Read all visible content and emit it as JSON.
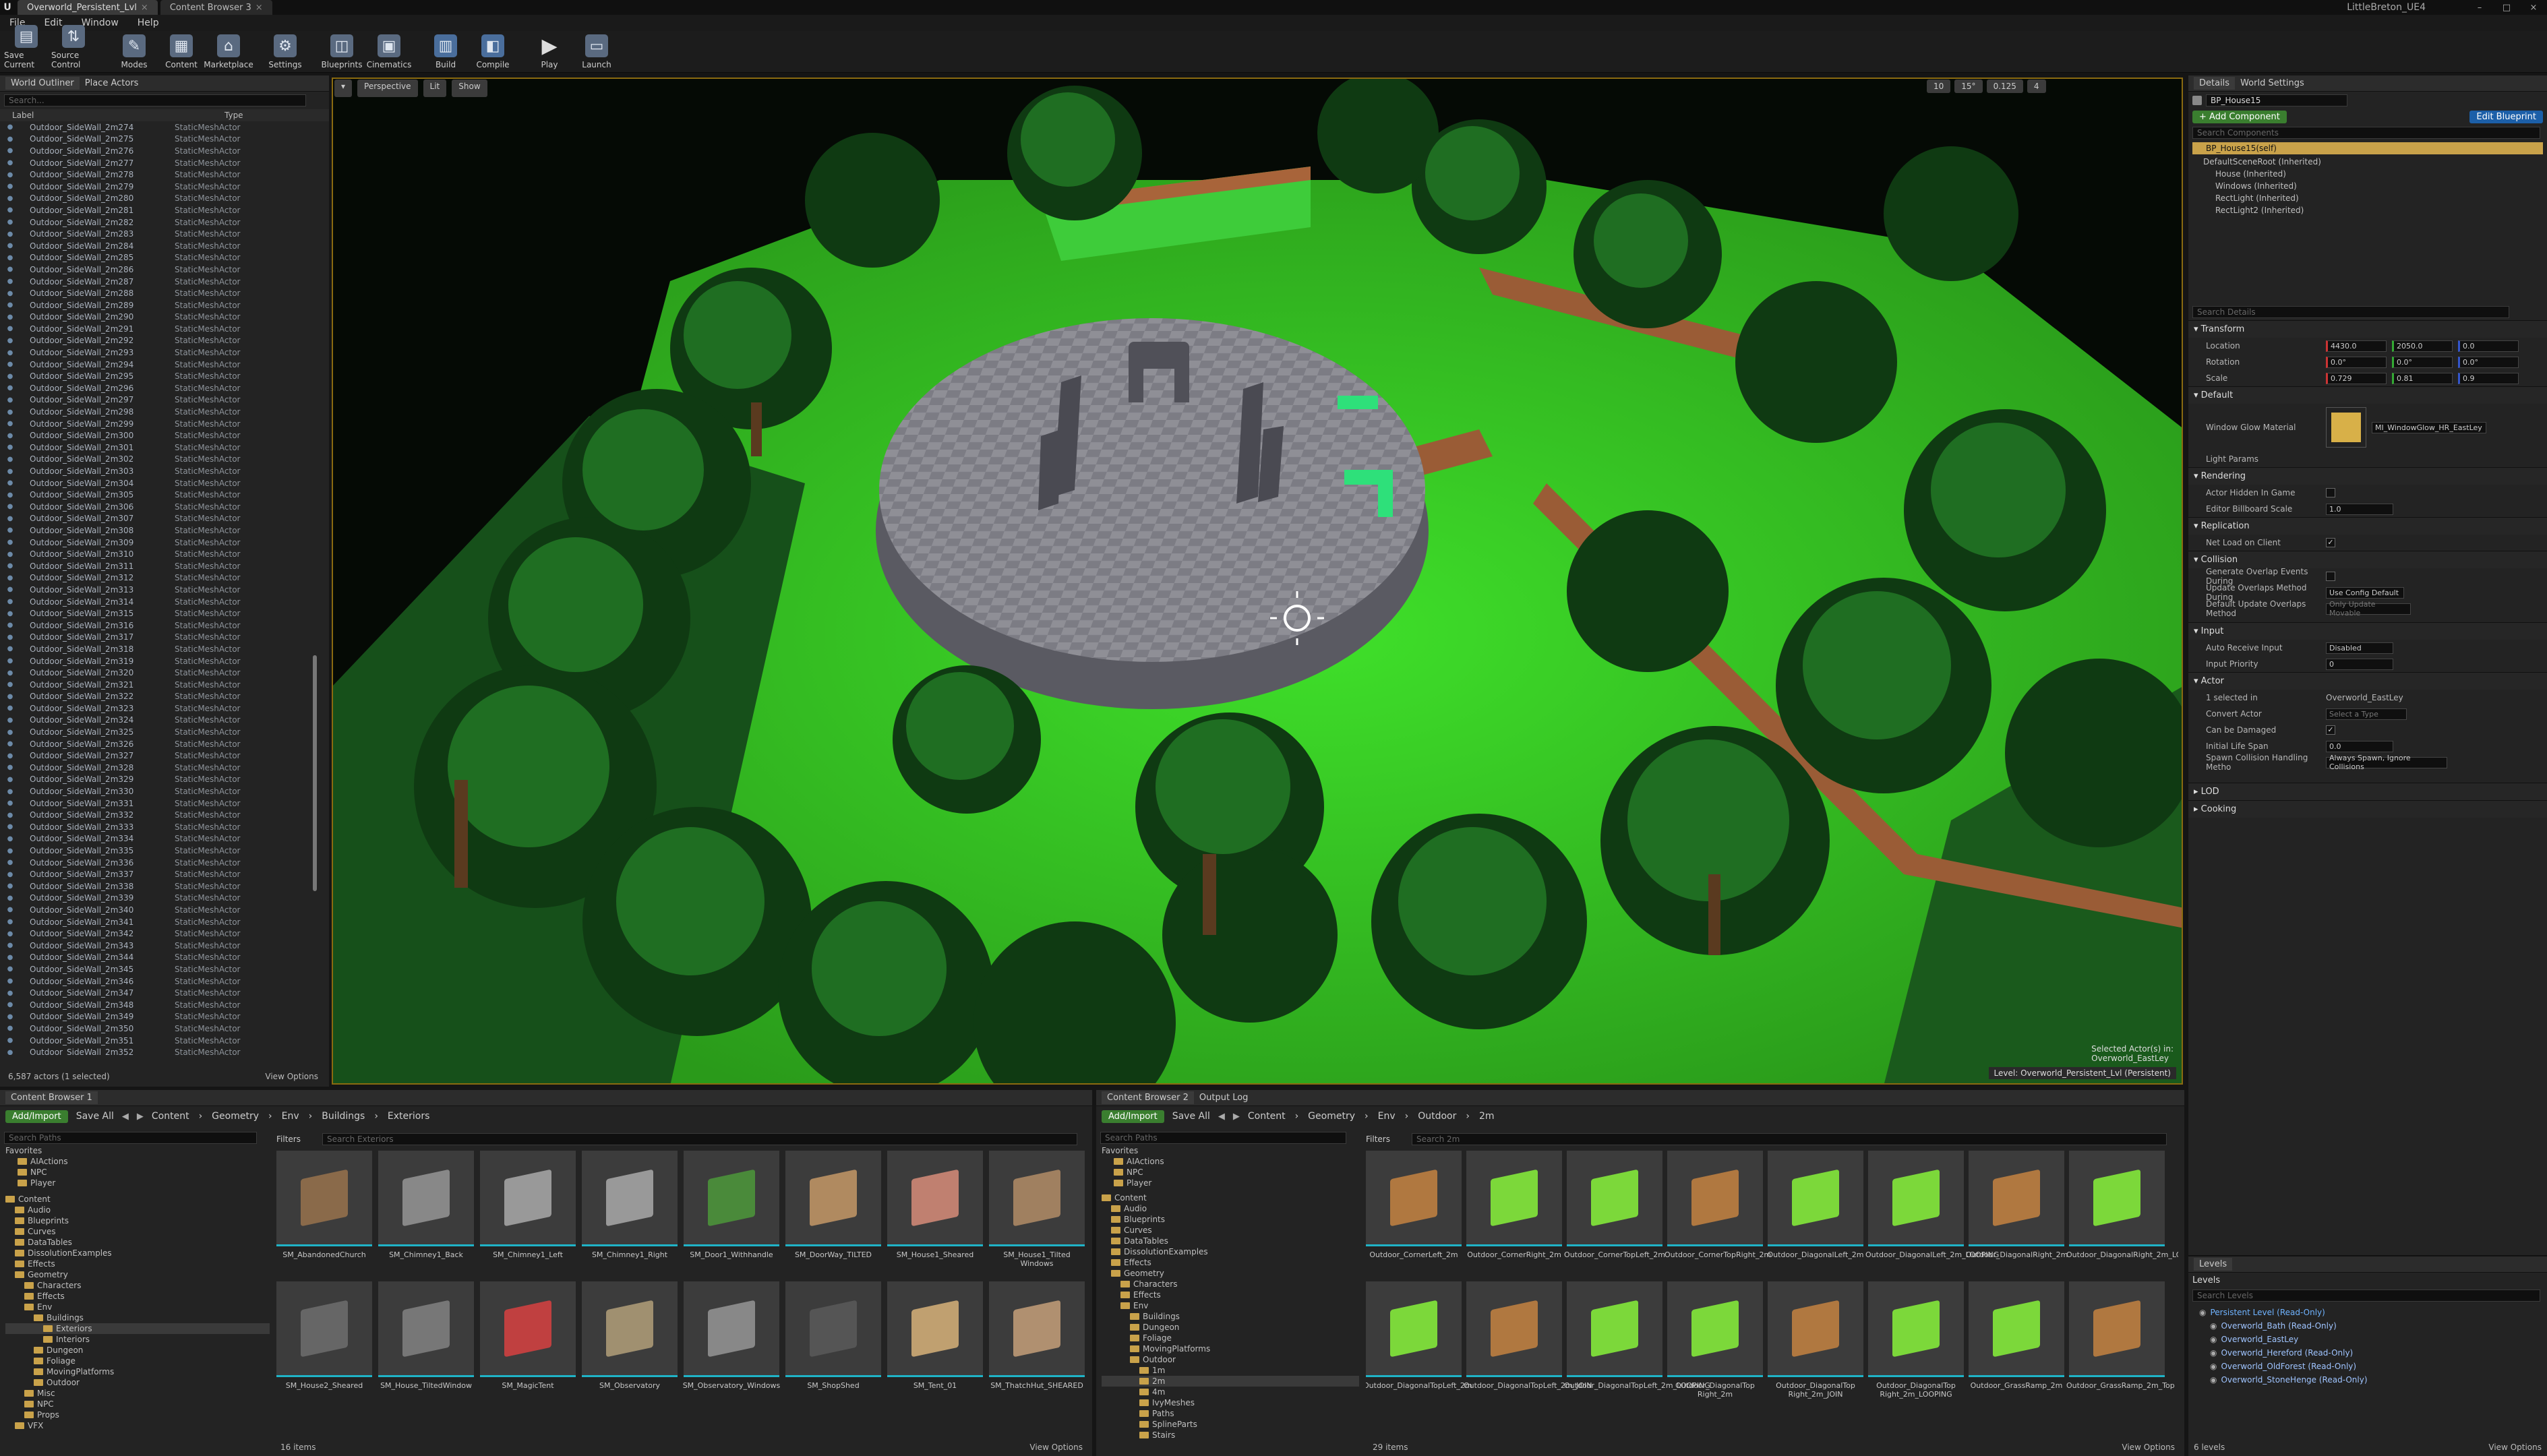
{
  "window": {
    "tabs": [
      "Overworld_Persistent_Lvl",
      "Content Browser 3"
    ],
    "project_name": "LittleBreton_UE4"
  },
  "menu": [
    "File",
    "Edit",
    "Window",
    "Help"
  ],
  "toolbar": [
    "Save Current",
    "Source Control",
    "Modes",
    "Content",
    "Marketplace",
    "Settings",
    "Blueprints",
    "Cinematics",
    "Build",
    "Compile",
    "Play",
    "Launch"
  ],
  "outliner": {
    "tabs": [
      "World Outliner",
      "Place Actors"
    ],
    "search_placeholder": "Search...",
    "col_label": "Label",
    "col_type": "Type",
    "rows": [
      {
        "n": "Outdoor_SideWall_2m274",
        "t": "StaticMeshActor"
      },
      {
        "n": "Outdoor_SideWall_2m275",
        "t": "StaticMeshActor"
      },
      {
        "n": "Outdoor_SideWall_2m276",
        "t": "StaticMeshActor"
      },
      {
        "n": "Outdoor_SideWall_2m277",
        "t": "StaticMeshActor"
      },
      {
        "n": "Outdoor_SideWall_2m278",
        "t": "StaticMeshActor"
      },
      {
        "n": "Outdoor_SideWall_2m279",
        "t": "StaticMeshActor"
      },
      {
        "n": "Outdoor_SideWall_2m280",
        "t": "StaticMeshActor"
      },
      {
        "n": "Outdoor_SideWall_2m281",
        "t": "StaticMeshActor"
      },
      {
        "n": "Outdoor_SideWall_2m282",
        "t": "StaticMeshActor"
      },
      {
        "n": "Outdoor_SideWall_2m283",
        "t": "StaticMeshActor"
      },
      {
        "n": "Outdoor_SideWall_2m284",
        "t": "StaticMeshActor"
      },
      {
        "n": "Outdoor_SideWall_2m285",
        "t": "StaticMeshActor"
      },
      {
        "n": "Outdoor_SideWall_2m286",
        "t": "StaticMeshActor"
      },
      {
        "n": "Outdoor_SideWall_2m287",
        "t": "StaticMeshActor"
      },
      {
        "n": "Outdoor_SideWall_2m288",
        "t": "StaticMeshActor"
      },
      {
        "n": "Outdoor_SideWall_2m289",
        "t": "StaticMeshActor"
      },
      {
        "n": "Outdoor_SideWall_2m290",
        "t": "StaticMeshActor"
      },
      {
        "n": "Outdoor_SideWall_2m291",
        "t": "StaticMeshActor"
      },
      {
        "n": "Outdoor_SideWall_2m292",
        "t": "StaticMeshActor"
      },
      {
        "n": "Outdoor_SideWall_2m293",
        "t": "StaticMeshActor"
      },
      {
        "n": "Outdoor_SideWall_2m294",
        "t": "StaticMeshActor"
      },
      {
        "n": "Outdoor_SideWall_2m295",
        "t": "StaticMeshActor"
      },
      {
        "n": "Outdoor_SideWall_2m296",
        "t": "StaticMeshActor"
      },
      {
        "n": "Outdoor_SideWall_2m297",
        "t": "StaticMeshActor"
      },
      {
        "n": "Outdoor_SideWall_2m298",
        "t": "StaticMeshActor"
      },
      {
        "n": "Outdoor_SideWall_2m299",
        "t": "StaticMeshActor"
      },
      {
        "n": "Outdoor_SideWall_2m300",
        "t": "StaticMeshActor"
      },
      {
        "n": "Outdoor_SideWall_2m301",
        "t": "StaticMeshActor"
      },
      {
        "n": "Outdoor_SideWall_2m302",
        "t": "StaticMeshActor"
      },
      {
        "n": "Outdoor_SideWall_2m303",
        "t": "StaticMeshActor"
      },
      {
        "n": "Outdoor_SideWall_2m304",
        "t": "StaticMeshActor"
      },
      {
        "n": "Outdoor_SideWall_2m305",
        "t": "StaticMeshActor"
      },
      {
        "n": "Outdoor_SideWall_2m306",
        "t": "StaticMeshActor"
      },
      {
        "n": "Outdoor_SideWall_2m307",
        "t": "StaticMeshActor"
      },
      {
        "n": "Outdoor_SideWall_2m308",
        "t": "StaticMeshActor"
      },
      {
        "n": "Outdoor_SideWall_2m309",
        "t": "StaticMeshActor"
      },
      {
        "n": "Outdoor_SideWall_2m310",
        "t": "StaticMeshActor"
      },
      {
        "n": "Outdoor_SideWall_2m311",
        "t": "StaticMeshActor"
      },
      {
        "n": "Outdoor_SideWall_2m312",
        "t": "StaticMeshActor"
      },
      {
        "n": "Outdoor_SideWall_2m313",
        "t": "StaticMeshActor"
      },
      {
        "n": "Outdoor_SideWall_2m314",
        "t": "StaticMeshActor"
      },
      {
        "n": "Outdoor_SideWall_2m315",
        "t": "StaticMeshActor"
      },
      {
        "n": "Outdoor_SideWall_2m316",
        "t": "StaticMeshActor"
      },
      {
        "n": "Outdoor_SideWall_2m317",
        "t": "StaticMeshActor"
      },
      {
        "n": "Outdoor_SideWall_2m318",
        "t": "StaticMeshActor"
      },
      {
        "n": "Outdoor_SideWall_2m319",
        "t": "StaticMeshActor"
      },
      {
        "n": "Outdoor_SideWall_2m320",
        "t": "StaticMeshActor"
      },
      {
        "n": "Outdoor_SideWall_2m321",
        "t": "StaticMeshActor"
      },
      {
        "n": "Outdoor_SideWall_2m322",
        "t": "StaticMeshActor"
      },
      {
        "n": "Outdoor_SideWall_2m323",
        "t": "StaticMeshActor"
      },
      {
        "n": "Outdoor_SideWall_2m324",
        "t": "StaticMeshActor"
      },
      {
        "n": "Outdoor_SideWall_2m325",
        "t": "StaticMeshActor"
      },
      {
        "n": "Outdoor_SideWall_2m326",
        "t": "StaticMeshActor"
      },
      {
        "n": "Outdoor_SideWall_2m327",
        "t": "StaticMeshActor"
      },
      {
        "n": "Outdoor_SideWall_2m328",
        "t": "StaticMeshActor"
      },
      {
        "n": "Outdoor_SideWall_2m329",
        "t": "StaticMeshActor"
      },
      {
        "n": "Outdoor_SideWall_2m330",
        "t": "StaticMeshActor"
      },
      {
        "n": "Outdoor_SideWall_2m331",
        "t": "StaticMeshActor"
      },
      {
        "n": "Outdoor_SideWall_2m332",
        "t": "StaticMeshActor"
      },
      {
        "n": "Outdoor_SideWall_2m333",
        "t": "StaticMeshActor"
      },
      {
        "n": "Outdoor_SideWall_2m334",
        "t": "StaticMeshActor"
      },
      {
        "n": "Outdoor_SideWall_2m335",
        "t": "StaticMeshActor"
      },
      {
        "n": "Outdoor_SideWall_2m336",
        "t": "StaticMeshActor"
      },
      {
        "n": "Outdoor_SideWall_2m337",
        "t": "StaticMeshActor"
      },
      {
        "n": "Outdoor_SideWall_2m338",
        "t": "StaticMeshActor"
      },
      {
        "n": "Outdoor_SideWall_2m339",
        "t": "StaticMeshActor"
      },
      {
        "n": "Outdoor_SideWall_2m340",
        "t": "StaticMeshActor"
      },
      {
        "n": "Outdoor_SideWall_2m341",
        "t": "StaticMeshActor"
      },
      {
        "n": "Outdoor_SideWall_2m342",
        "t": "StaticMeshActor"
      },
      {
        "n": "Outdoor_SideWall_2m343",
        "t": "StaticMeshActor"
      },
      {
        "n": "Outdoor_SideWall_2m344",
        "t": "StaticMeshActor"
      },
      {
        "n": "Outdoor_SideWall_2m345",
        "t": "StaticMeshActor"
      },
      {
        "n": "Outdoor_SideWall_2m346",
        "t": "StaticMeshActor"
      },
      {
        "n": "Outdoor_SideWall_2m347",
        "t": "StaticMeshActor"
      },
      {
        "n": "Outdoor_SideWall_2m348",
        "t": "StaticMeshActor"
      },
      {
        "n": "Outdoor_SideWall_2m349",
        "t": "StaticMeshActor"
      },
      {
        "n": "Outdoor_SideWall_2m350",
        "t": "StaticMeshActor"
      },
      {
        "n": "Outdoor_SideWall_2m351",
        "t": "StaticMeshActor"
      },
      {
        "n": "Outdoor_SideWall_2m352",
        "t": "StaticMeshActor"
      }
    ],
    "footer": "6,587 actors (1 selected)",
    "view_options": "View Options"
  },
  "viewport": {
    "buttons": [
      "Perspective",
      "Lit",
      "Show"
    ],
    "snap_values": [
      "10",
      "15°",
      "0.125",
      "4"
    ],
    "selected_info": "Selected Actor(s) in:",
    "selected_level": "Overworld_EastLey",
    "level_label": "Level:  Overworld_Persistent_Lvl (Persistent)"
  },
  "details": {
    "tabs": [
      "Details",
      "World Settings"
    ],
    "actor_name": "BP_House15",
    "add_component": "+ Add Component",
    "edit_blueprint": "Edit Blueprint",
    "search_components": "Search Components",
    "components": [
      "BP_House15(self)",
      "DefaultSceneRoot (Inherited)",
      "House (Inherited)",
      "Windows (Inherited)",
      "RectLight (Inherited)",
      "RectLight2 (Inherited)"
    ],
    "search_details": "Search Details",
    "transform_title": "Transform",
    "location_label": "Location",
    "location": [
      "4430.0",
      "2050.0",
      "0.0"
    ],
    "rotation_label": "Rotation",
    "rotation": [
      "0.0°",
      "0.0°",
      "0.0°"
    ],
    "scale_label": "Scale",
    "scale": [
      "0.729",
      "0.81",
      "0.9"
    ],
    "default_title": "Default",
    "window_glow_label": "Window Glow Material",
    "window_glow_value": "MI_WindowGlow_HR_EastLey",
    "light_params_label": "Light Params",
    "rendering_title": "Rendering",
    "actor_hidden_label": "Actor Hidden In Game",
    "billboard_label": "Editor Billboard Scale",
    "billboard_value": "1.0",
    "replication_title": "Replication",
    "net_load_label": "Net Load on Client",
    "collision_title": "Collision",
    "gen_overlap_label": "Generate Overlap Events During",
    "update_overlap_label": "Update Overlaps Method During",
    "update_overlap_value": "Use Config Default",
    "default_update_label": "Default Update Overlaps Method",
    "default_update_value": "Only Update Movable",
    "input_title": "Input",
    "auto_receive_label": "Auto Receive Input",
    "auto_receive_value": "Disabled",
    "input_priority_label": "Input Priority",
    "input_priority_value": "0",
    "actor_title": "Actor",
    "selected_in_label": "1 selected in",
    "selected_in_value": "Overworld_EastLey",
    "convert_actor_label": "Convert Actor",
    "convert_actor_value": "Select a Type",
    "can_be_damaged_label": "Can be Damaged",
    "initial_life_label": "Initial Life Span",
    "initial_life_value": "0.0",
    "spawn_collision_label": "Spawn Collision Handling Metho",
    "spawn_collision_value": "Always Spawn, Ignore Collisions",
    "lod_title": "LOD",
    "cooking_title": "Cooking"
  },
  "levels": {
    "tab": "Levels",
    "header": "Levels",
    "search": "Search Levels",
    "items": [
      "Persistent Level (Read-Only)",
      "Overworld_Bath (Read-Only)",
      "Overworld_EastLey",
      "Overworld_Hereford (Read-Only)",
      "Overworld_OldForest (Read-Only)",
      "Overworld_StoneHenge (Read-Only)"
    ],
    "count": "6 levels",
    "view_options": "View Options"
  },
  "cb1": {
    "tab": "Content Browser 1",
    "add_import": "Add/Import",
    "save_all": "Save All",
    "path": [
      "Content",
      "Geometry",
      "Env",
      "Buildings",
      "Exteriors"
    ],
    "search_paths": "Search Paths",
    "filters": "Filters",
    "search_assets": "Search Exteriors",
    "favorites": "Favorites",
    "fav_items": [
      "AIActions",
      "NPC",
      "Player"
    ],
    "tree": [
      "Content",
      "Audio",
      "Blueprints",
      "Curves",
      "DataTables",
      "DissolutionExamples",
      "Effects",
      "Geometry",
      "Characters",
      "Effects",
      "Env",
      "Buildings",
      "Exteriors",
      "Interiors",
      "Dungeon",
      "Foliage",
      "MovingPlatforms",
      "Outdoor",
      "Misc",
      "NPC",
      "Props",
      "VFX"
    ],
    "assets": [
      "SM_AbandonedChurch",
      "SM_Chimney1_Back",
      "SM_Chimney1_Left",
      "SM_Chimney1_Right",
      "SM_Door1_Withhandle",
      "SM_DoorWay_TILTED",
      "SM_House1_Sheared",
      "SM_House1_Tilted Windows",
      "SM_House2_Sheared",
      "SM_House_TiltedWindow",
      "SM_MagicTent",
      "SM_Observatory",
      "SM_Observatory_Windows",
      "SM_ShopShed",
      "SM_Tent_01",
      "SM_ThatchHut_SHEARED"
    ],
    "count": "16 items",
    "view_options": "View Options"
  },
  "cb2": {
    "tabs": [
      "Content Browser 2",
      "Output Log"
    ],
    "add_import": "Add/Import",
    "save_all": "Save All",
    "path": [
      "Content",
      "Geometry",
      "Env",
      "Outdoor",
      "2m"
    ],
    "search_paths": "Search Paths",
    "filters": "Filters",
    "search_assets": "Search 2m",
    "favorites": "Favorites",
    "fav_items": [
      "AIActions",
      "NPC",
      "Player"
    ],
    "tree": [
      "Content",
      "Audio",
      "Blueprints",
      "Curves",
      "DataTables",
      "DissolutionExamples",
      "Effects",
      "Geometry",
      "Characters",
      "Effects",
      "Env",
      "Buildings",
      "Dungeon",
      "Foliage",
      "MovingPlatforms",
      "Outdoor",
      "1m",
      "2m",
      "4m",
      "IvyMeshes",
      "Paths",
      "SplineParts",
      "Stairs"
    ],
    "assets": [
      "Outdoor_CornerLeft_2m",
      "Outdoor_CornerRight_2m",
      "Outdoor_CornerTopLeft_2m",
      "Outdoor_CornerTopRight_2m",
      "Outdoor_DiagonalLeft_2m",
      "Outdoor_DiagonalLeft_2m_LOOPING",
      "Outdoor_DiagonalRight_2m",
      "Outdoor_DiagonalRight_2m_LOOPING",
      "Outdoor_DiagonalTopLeft_2m",
      "Outdoor_DiagonalTopLeft_2m_JOIN",
      "Outdoor_DiagonalTopLeft_2m_LOOPING",
      "Outdoor_DiagonalTop Right_2m",
      "Outdoor_DiagonalTop Right_2m_JOIN",
      "Outdoor_DiagonalTop Right_2m_LOOPING",
      "Outdoor_GrassRamp_2m",
      "Outdoor_GrassRamp_2m_Top"
    ],
    "count": "29 items",
    "view_options": "View Options"
  }
}
